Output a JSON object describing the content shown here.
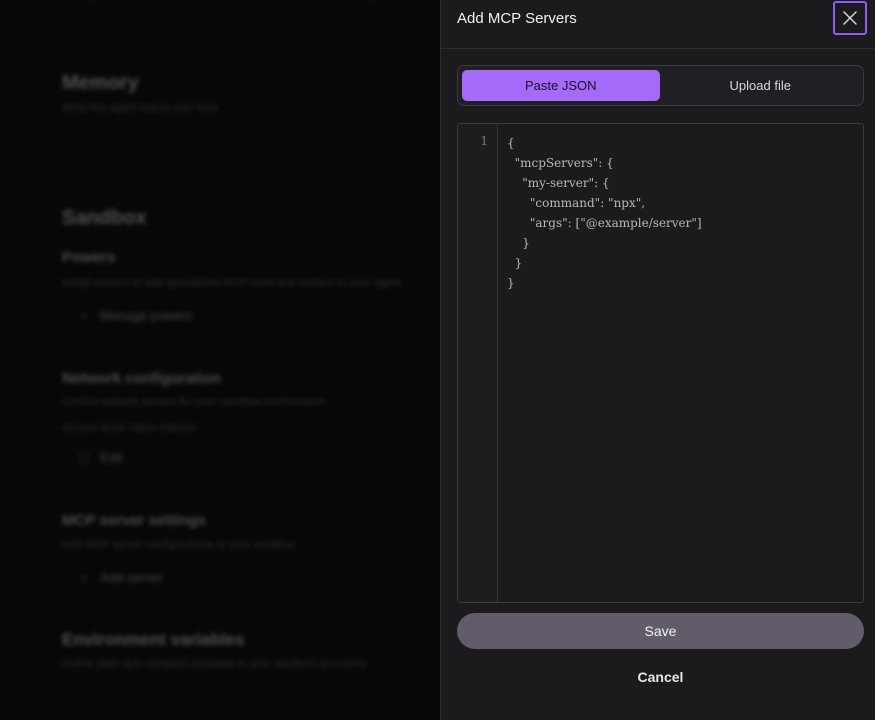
{
  "background": {
    "top_line_left": "— — — —",
    "top_line_right": "— — —",
    "memory": {
      "title": "Memory",
      "description": "What the agent learns over time"
    },
    "sandbox": {
      "title": "Sandbox"
    },
    "powers": {
      "title": "Powers",
      "description": "Install powers to add specialized MCP tools and context to your agent",
      "item_label": "Manage powers"
    },
    "network": {
      "title": "Network configuration",
      "description": "Control network access for your sandbox environment",
      "access_text": "Access level: Open internet",
      "edit_label": "Edit"
    },
    "mcp_settings": {
      "title": "MCP server settings",
      "description": "Add MCP server configurations to your sandbox",
      "item_label": "Add server"
    },
    "env": {
      "title": "Environment variables",
      "description": "Define plain text variables available to your sandbox at runtime"
    }
  },
  "drawer": {
    "title": "Add MCP Servers",
    "tabs": [
      {
        "label": "Paste JSON",
        "active": true
      },
      {
        "label": "Upload file",
        "active": false
      }
    ],
    "editor": {
      "line_number": "1",
      "lines": [
        "{",
        "  \"mcpServers\": {",
        "    \"my-server\": {",
        "      \"command\": \"npx\",",
        "      \"args\": [\"@example/server\"]",
        "    }",
        "  }",
        "}"
      ]
    },
    "save_label": "Save",
    "cancel_label": "Cancel"
  },
  "colors": {
    "accent": "#a36bf7",
    "focus_ring": "#8b5cf6",
    "save_button": "#625b69",
    "panel": "#1b1b1e"
  }
}
